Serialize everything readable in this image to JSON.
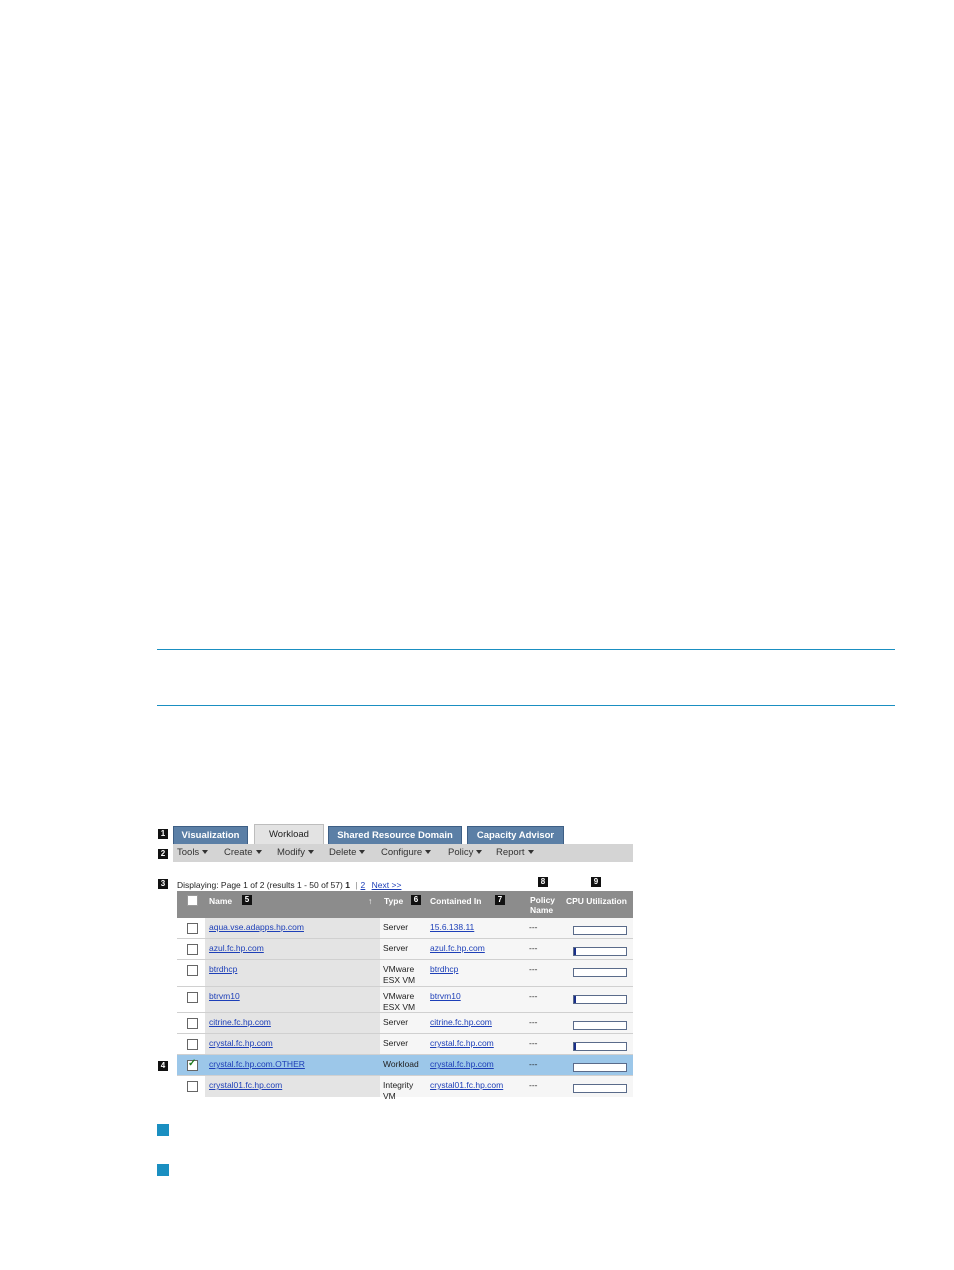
{
  "tabs": [
    "Visualization",
    "Workload",
    "Shared Resource Domain",
    "Capacity Advisor"
  ],
  "active_tab": "Workload",
  "menus": [
    "Tools",
    "Create",
    "Modify",
    "Delete",
    "Configure",
    "Policy",
    "Report"
  ],
  "pager": {
    "text": "Displaying: Page 1 of 2 (results 1 - 50 of 57)",
    "current": "1",
    "separator": "|",
    "page2": "2",
    "next": "Next >>"
  },
  "columns": {
    "name": "Name",
    "sort_indicator": "↑",
    "type": "Type",
    "contained_in": "Contained In",
    "policy_line1": "Policy",
    "policy_line2": "Name",
    "cpu": "CPU Utilization"
  },
  "callouts": [
    "1",
    "2",
    "3",
    "4",
    "5",
    "6",
    "7",
    "8",
    "9"
  ],
  "rows": [
    {
      "name": "aqua.vse.adapps.hp.com",
      "type": "Server",
      "type2": "",
      "contained": "15.6.138.11",
      "policy": "---",
      "cpu": 0.0,
      "checked": false
    },
    {
      "name": "azul.fc.hp.com",
      "type": "Server",
      "type2": "",
      "contained": "azul.fc.hp.com",
      "policy": "---",
      "cpu": 0.04,
      "checked": false
    },
    {
      "name": "btrdhcp",
      "type": "VMware",
      "type2": "ESX VM",
      "contained": "btrdhcp",
      "policy": "---",
      "cpu": 0.0,
      "checked": false
    },
    {
      "name": "btrvm10",
      "type": "VMware",
      "type2": "ESX VM",
      "contained": "btrvm10",
      "policy": "---",
      "cpu": 0.03,
      "checked": false
    },
    {
      "name": "citrine.fc.hp.com",
      "type": "Server",
      "type2": "",
      "contained": "citrine.fc.hp.com",
      "policy": "---",
      "cpu": 0.0,
      "checked": false
    },
    {
      "name": "crystal.fc.hp.com",
      "type": "Server",
      "type2": "",
      "contained": "crystal.fc.hp.com",
      "policy": "---",
      "cpu": 0.04,
      "checked": false
    },
    {
      "name": "crystal.fc.hp.com.OTHER",
      "type": "Workload",
      "type2": "",
      "contained": "crystal.fc.hp.com",
      "policy": "---",
      "cpu": 0.0,
      "checked": true
    },
    {
      "name": "crystal01.fc.hp.com",
      "type": "Integrity",
      "type2": "VM",
      "contained": "crystal01.fc.hp.com",
      "policy": "---",
      "cpu": 0.0,
      "checked": false
    }
  ],
  "colors": {
    "rule": "#1a8fc1",
    "tab": "#5b7fa6",
    "selected_row": "#9cc7e9",
    "link": "#1d3fb8"
  }
}
